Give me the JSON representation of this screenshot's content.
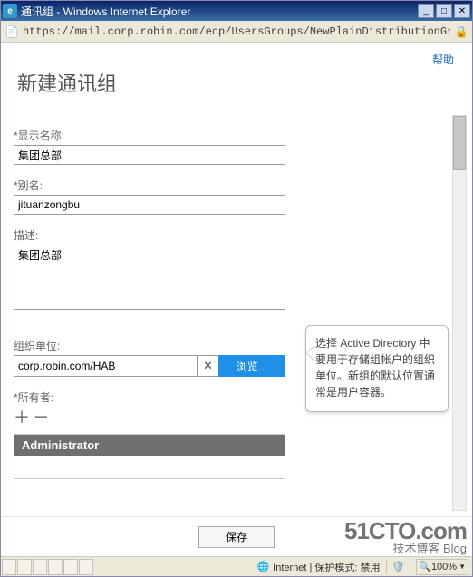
{
  "window": {
    "title": "通讯组 - Windows Internet Explorer",
    "url": "https://mail.corp.robin.com/ecp/UsersGroups/NewPlainDistributionGroup.aspx?p"
  },
  "page": {
    "help": "帮助",
    "heading": "新建通讯组"
  },
  "form": {
    "display_name_label": "*显示名称:",
    "display_name_value": "集团总部",
    "alias_label": "*别名:",
    "alias_value": "jituanzongbu",
    "desc_label": "描述:",
    "desc_value": "集团总部",
    "ou_label": "组织单位:",
    "ou_value": "corp.robin.com/HAB",
    "ou_clear": "✕",
    "ou_browse": "浏览...",
    "owner_label": "*所有者:",
    "add_symbol": "＋",
    "remove_symbol": "－",
    "owner_header": "Administrator",
    "save": "保存"
  },
  "tooltip": {
    "text": "选择 Active Directory 中要用于存储组帐户的组织单位。新组的默认位置通常是用户容器。"
  },
  "status": {
    "zone": "Internet | 保护模式: 禁用",
    "zoom": "100%"
  },
  "watermark": {
    "line1": "51CTO.com",
    "line2": "技术博客     Blog"
  }
}
